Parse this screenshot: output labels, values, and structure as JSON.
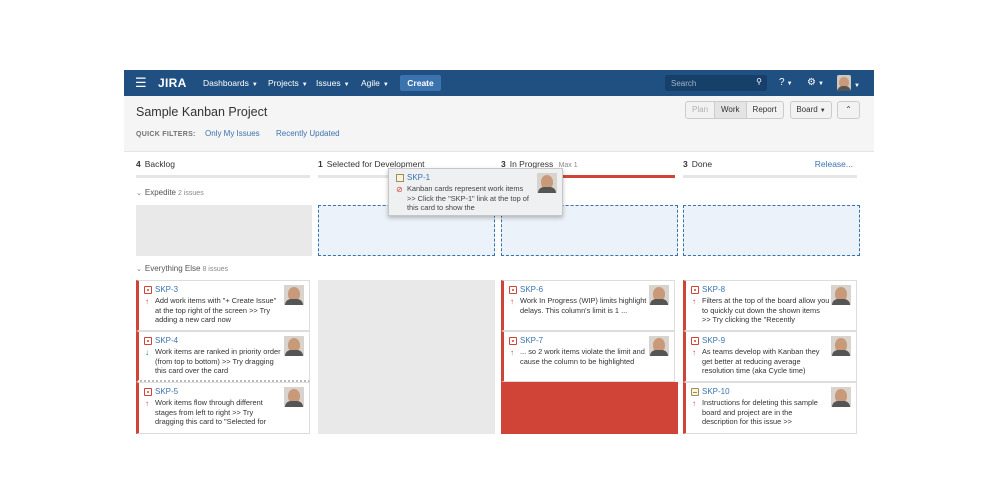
{
  "header": {
    "logo": "JIRA",
    "nav": [
      {
        "label": "Dashboards"
      },
      {
        "label": "Projects"
      },
      {
        "label": "Issues"
      },
      {
        "label": "Agile"
      }
    ],
    "create_label": "Create",
    "search_placeholder": "Search",
    "brand_color": "#205081"
  },
  "subheader": {
    "project_title": "Sample Kanban Project",
    "quick_filters_label": "QUICK FILTERS:",
    "quick_filters": [
      "Only My Issues",
      "Recently Updated"
    ],
    "mode_buttons": [
      "Plan",
      "Work",
      "Report"
    ],
    "active_mode": "Work",
    "board_label": "Board",
    "collapse_glyph": "⌃"
  },
  "columns": [
    {
      "count": "4",
      "name": "Backlog"
    },
    {
      "count": "1",
      "name": "Selected for Development"
    },
    {
      "count": "3",
      "name": "In Progress",
      "max": "Max 1"
    },
    {
      "count": "3",
      "name": "Done",
      "action": "Release..."
    }
  ],
  "swimlanes": [
    {
      "name": "Expedite",
      "count": "2 issues"
    },
    {
      "name": "Everything Else",
      "count": "8 issues"
    }
  ],
  "drag_card": {
    "key": "SKP-1",
    "summary": "Kanban cards represent work items >> Click the \"SKP-1\" link at the top of this card to show the"
  },
  "cards": {
    "skp3": {
      "key": "SKP-3",
      "summary": "Add work items with \"+ Create Issue\" at the top right of the screen >> Try adding a new card now"
    },
    "skp4": {
      "key": "SKP-4",
      "summary": "Work items are ranked in priority order (from top to bottom) >> Try dragging this card over the card"
    },
    "skp5": {
      "key": "SKP-5",
      "summary": "Work items flow through different stages from left to right >> Try dragging this card to \"Selected for"
    },
    "skp6": {
      "key": "SKP-6",
      "summary": "Work In Progress (WIP) limits highlight delays. This column's limit is 1 ..."
    },
    "skp7": {
      "key": "SKP-7",
      "summary": "... so 2 work items violate the limit and cause the column to be highlighted"
    },
    "skp8": {
      "key": "SKP-8",
      "summary": "Filters at the top of the board allow you to quickly cut down the shown items >> Try clicking the \"Recently"
    },
    "skp9": {
      "key": "SKP-9",
      "summary": "As teams develop with Kanban they get better at reducing average resolution time (aka Cycle time)"
    },
    "skp10": {
      "key": "SKP-10",
      "summary": "Instructions for deleting this sample board and project are in the description for this issue >>"
    }
  }
}
